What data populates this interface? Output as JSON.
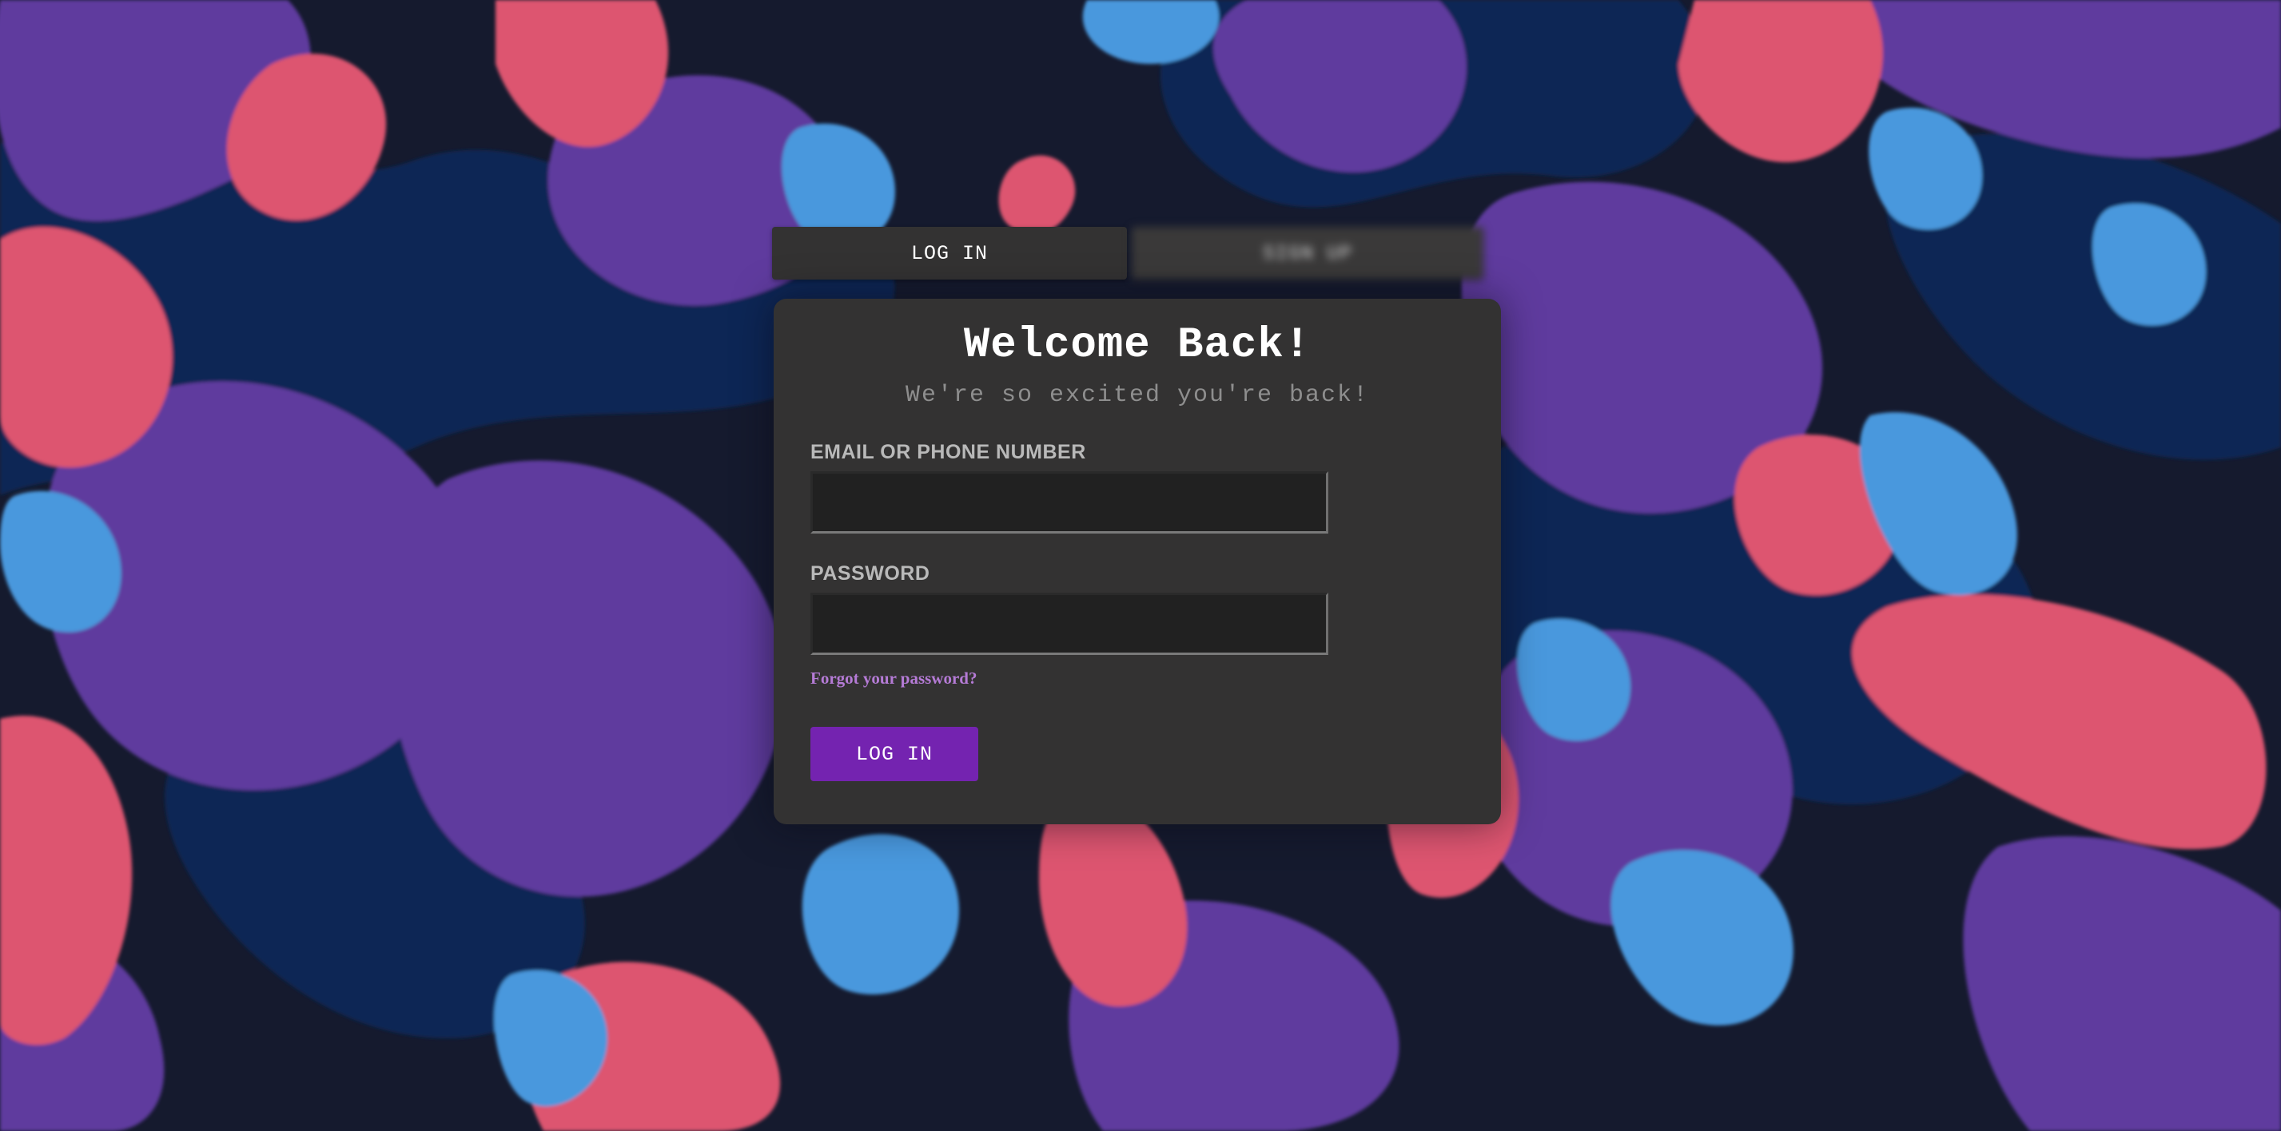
{
  "tabs": {
    "login_label": "LOG IN",
    "signup_label": "SIGN UP"
  },
  "form": {
    "title": "Welcome Back!",
    "subtitle": "We're so excited you're back!",
    "email_label": "EMAIL OR PHONE NUMBER",
    "email_value": "",
    "password_label": "PASSWORD",
    "password_value": "",
    "forgot_link": "Forgot your password?",
    "submit_label": "LOG IN"
  },
  "colors": {
    "background_dark": "#151a2e",
    "panel": "#333232",
    "field": "#212121",
    "accent_purple": "#7423b0",
    "link_purple": "#b57bd6",
    "blob_purple": "#5f3a9e",
    "blob_pink": "#dd5470",
    "blob_blue": "#4a98dd",
    "blob_navy": "#102654"
  }
}
